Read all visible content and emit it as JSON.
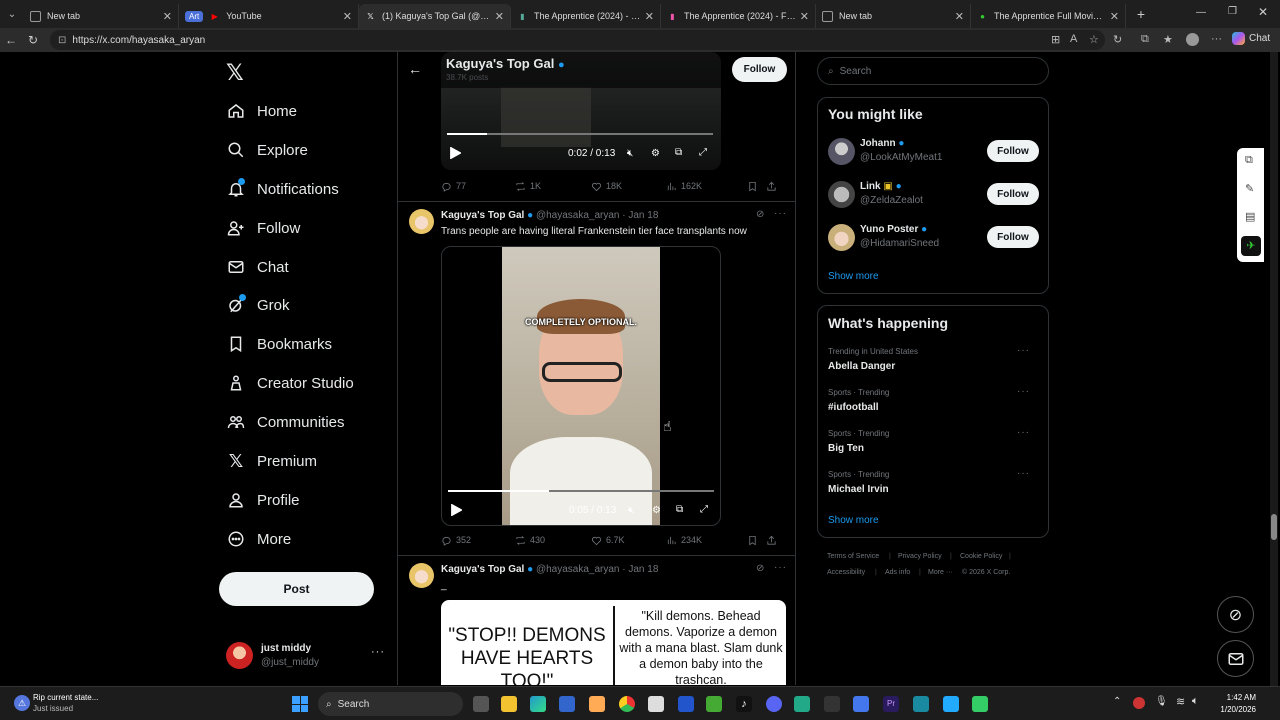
{
  "browser": {
    "tabs": [
      {
        "title": "New tab",
        "active": false
      },
      {
        "title": "YouTube",
        "active": false,
        "badge": "Art"
      },
      {
        "title": "(1) Kaguya's Top Gal (@hayasaka_aryan",
        "active": true
      },
      {
        "title": "The Apprentice (2024) - 1Shows",
        "active": false
      },
      {
        "title": "The Apprentice (2024) - FilmCave",
        "active": false
      },
      {
        "title": "New tab",
        "active": false
      },
      {
        "title": "The Apprentice Full Movie Watch",
        "active": false
      }
    ],
    "url": "https://x.com/hayasaka_aryan",
    "copilot_label": "Chat"
  },
  "nav": {
    "items": [
      {
        "label": "Home",
        "icon": "home-icon"
      },
      {
        "label": "Explore",
        "icon": "search-icon"
      },
      {
        "label": "Notifications",
        "icon": "bell-icon"
      },
      {
        "label": "Follow",
        "icon": "follow-icon"
      },
      {
        "label": "Chat",
        "icon": "mail-icon"
      },
      {
        "label": "Grok",
        "icon": "grok-icon"
      },
      {
        "label": "Bookmarks",
        "icon": "bookmark-icon"
      },
      {
        "label": "Creator Studio",
        "icon": "creator-icon"
      },
      {
        "label": "Communities",
        "icon": "communities-icon"
      },
      {
        "label": "Premium",
        "icon": "x-icon"
      },
      {
        "label": "Profile",
        "icon": "profile-icon"
      },
      {
        "label": "More",
        "icon": "more-icon"
      }
    ],
    "post_label": "Post",
    "account": {
      "name": "just middy",
      "handle": "@just_middy"
    }
  },
  "profile_header": {
    "name": "Kaguya's Top Gal",
    "posts_count": "38.7K posts",
    "follow_label": "Follow"
  },
  "feed": {
    "first_post": {
      "video_time": "0:02 / 0:13",
      "video_progress": 0.15,
      "replies": "77",
      "reposts": "1K",
      "likes": "18K",
      "views": "162K"
    },
    "second_post": {
      "author": "Kaguya's Top Gal",
      "handle": "@hayasaka_aryan",
      "date": "· Jan 18",
      "text": "Trans people are having literal Frankenstein tier face transplants now",
      "caption": "COMPLETELY OPTIONAL.",
      "video_time": "0:05 / 0:13",
      "video_progress": 0.38,
      "replies": "352",
      "reposts": "430",
      "likes": "6.7K",
      "views": "234K"
    },
    "third_post": {
      "author": "Kaguya's Top Gal",
      "handle": "@hayasaka_aryan",
      "date": "· Jan 18",
      "text": "_",
      "meme_left": "\"STOP!! DEMONS HAVE HEARTS TOO!\"",
      "meme_right": "\"Kill demons. Behead demons. Vaporize a demon with a mana blast. Slam dunk a demon baby into the trashcan."
    }
  },
  "right": {
    "search_placeholder": "Search",
    "you_might_like": {
      "title": "You might like",
      "users": [
        {
          "name": "Johann",
          "handle": "@LookAtMyMeat1"
        },
        {
          "name": "Link",
          "handle": "@ZeldaZealot"
        },
        {
          "name": "Yuno Poster",
          "handle": "@HidamariSneed"
        }
      ],
      "follow_label": "Follow",
      "show_more": "Show more"
    },
    "whats_happening": {
      "title": "What's happening",
      "trends": [
        {
          "category": "Trending in United States",
          "name": "Abella Danger"
        },
        {
          "category": "Sports · Trending",
          "name": "#iufootball"
        },
        {
          "category": "Sports · Trending",
          "name": "Big Ten"
        },
        {
          "category": "Sports · Trending",
          "name": "Michael Irvin"
        }
      ],
      "show_more": "Show more"
    },
    "footer_links": [
      "Terms of Service",
      "Privacy Policy",
      "Cookie Policy",
      "Accessibility",
      "Ads info",
      "More ···",
      "© 2026 X Corp."
    ]
  },
  "taskbar": {
    "notification_title": "Rip current state...",
    "notification_sub": "Just issued",
    "search_label": "Search",
    "time": "1:42 AM",
    "date": "1/20/2026"
  }
}
